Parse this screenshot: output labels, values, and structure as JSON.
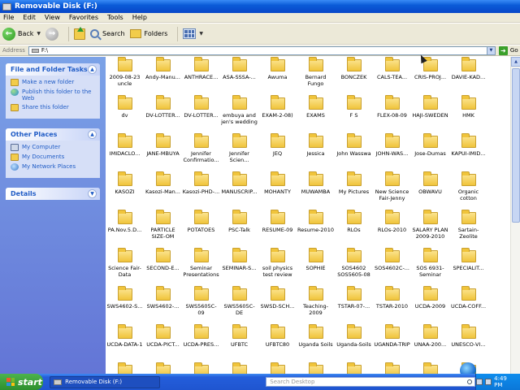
{
  "window": {
    "title": "Removable Disk (F:)"
  },
  "menu": [
    "File",
    "Edit",
    "View",
    "Favorites",
    "Tools",
    "Help"
  ],
  "toolbar": {
    "back_label": "Back",
    "search_label": "Search",
    "folders_label": "Folders"
  },
  "address": {
    "label": "Address",
    "value": "F:\\",
    "go_label": "Go"
  },
  "taskpane": {
    "file_tasks": {
      "title": "File and Folder Tasks",
      "items": [
        "Make a new folder",
        "Publish this folder to the Web",
        "Share this folder"
      ]
    },
    "other_places": {
      "title": "Other Places",
      "items": [
        "My Computer",
        "My Documents",
        "My Network Places"
      ]
    },
    "details": {
      "title": "Details"
    }
  },
  "files": [
    "2009-08-23 uncle",
    "Andy-Manu...",
    "ANTHRACE...",
    "ASA-SSSA-...",
    "Awuma",
    "Bernard Fungo",
    "BONCZEK",
    "CALS-TEA...",
    "CRIS-PROJ...",
    "DAVIE-KAD...",
    "dv",
    "DV-LOTTER...",
    "DV-LOTTER...",
    "embuya and jen's wedding",
    "EXAM-2-08)",
    "EXAMS",
    "F S",
    "FLEX-08-09",
    "HAJI-SWEDEN",
    "HMK",
    "IMIDACLO...",
    "JANE-MBUYA",
    "Jennifer Confirmatio...",
    "Jennifer Scien...",
    "JEQ",
    "Jessica",
    "John Wasswa",
    "JOHN-WAS...",
    "Jose-Dumas",
    "KAPUI-IMID...",
    "KASOZI",
    "Kasozi-Man...",
    "Kasozi-PHD-...",
    "MANUSCRIP...",
    "MOHANTY",
    "MUWAMBA",
    "My Pictures",
    "New Science Fair-Jenny",
    "OBWAVU",
    "Organic cotton",
    "PA.Nov.5.D...",
    "PARTICLE SIZE-OM",
    "POTATOES",
    "PSC-Talk",
    "RESUME-09",
    "Resume-2010",
    "RLOs",
    "RLOs-2010",
    "SALARY PLAN 2009-2010",
    "Sartain-Zeolite",
    "Science Fair-Data",
    "SECOND-E...",
    "Seminar Presentations",
    "SEMINAR-S...",
    "soil physics test review",
    "SOPHIE",
    "SOS4602 SOS5605-08",
    "SOS4602C-...",
    "SOS 6931-Seminar",
    "SPECIALIT...",
    "SWS4602-S...",
    "SWS4602-...",
    "SWS5605C-09",
    "SWS5605C-DE",
    "SWSD-SCH...",
    "Teaching-2009",
    "TSTAR-07-...",
    "TSTAR-2010",
    "UCDA-2009",
    "UCDA-COFF...",
    "UCDA-DATA-1",
    "UCDA-PICT...",
    "UCDA-PRES...",
    "UFBTC",
    "UFBTC80",
    "Uganda Soils",
    "Uganda-Soils",
    "UGANDA-TRIP",
    "UNAA-200...",
    "UNESCO-VI...",
    "",
    "",
    "",
    "",
    "",
    "",
    "",
    "",
    "",
    ""
  ],
  "taskbar": {
    "start_label": "start",
    "window_button": "Removable Disk (F:)",
    "search_placeholder": "Search Desktop",
    "clock": "4:49 PM"
  }
}
